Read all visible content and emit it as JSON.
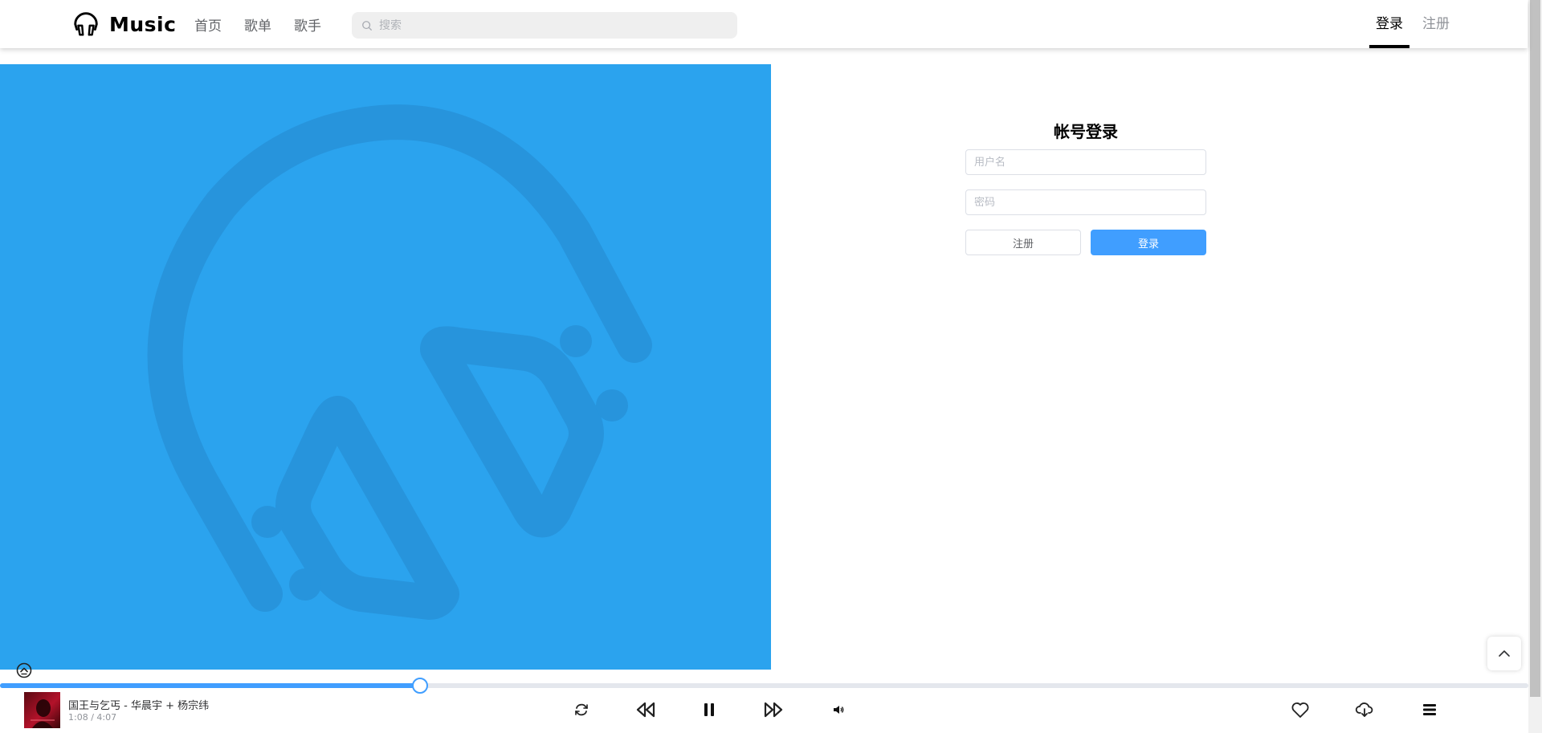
{
  "header": {
    "logo_icon": "headphones-icon",
    "logo_text": "Music",
    "nav": [
      {
        "label": "首页"
      },
      {
        "label": "歌单"
      },
      {
        "label": "歌手"
      }
    ],
    "search": {
      "icon": "search-icon",
      "placeholder": "搜索",
      "value": ""
    },
    "auth": {
      "login_label": "登录",
      "register_label": "注册",
      "active": "登录"
    }
  },
  "banner": {
    "color": "#2ba3ee",
    "icon": "headphones-icon"
  },
  "login_form": {
    "title": "帐号登录",
    "username_placeholder": "用户名",
    "password_placeholder": "密码",
    "register_button": "注册",
    "login_button": "登录"
  },
  "player": {
    "song_title": "国王与乞丐 - 华晨宇 + 杨宗纬",
    "time": "1:08 / 4:07",
    "progress_fraction": 0.275,
    "controls": [
      "loop-icon",
      "previous-icon",
      "pause-icon",
      "next-icon",
      "volume-icon"
    ],
    "actions": [
      "heart-icon",
      "download-icon",
      "playlist-icon"
    ],
    "accent_color": "#409eff"
  },
  "back_to_top_icon": "chevron-up-icon"
}
